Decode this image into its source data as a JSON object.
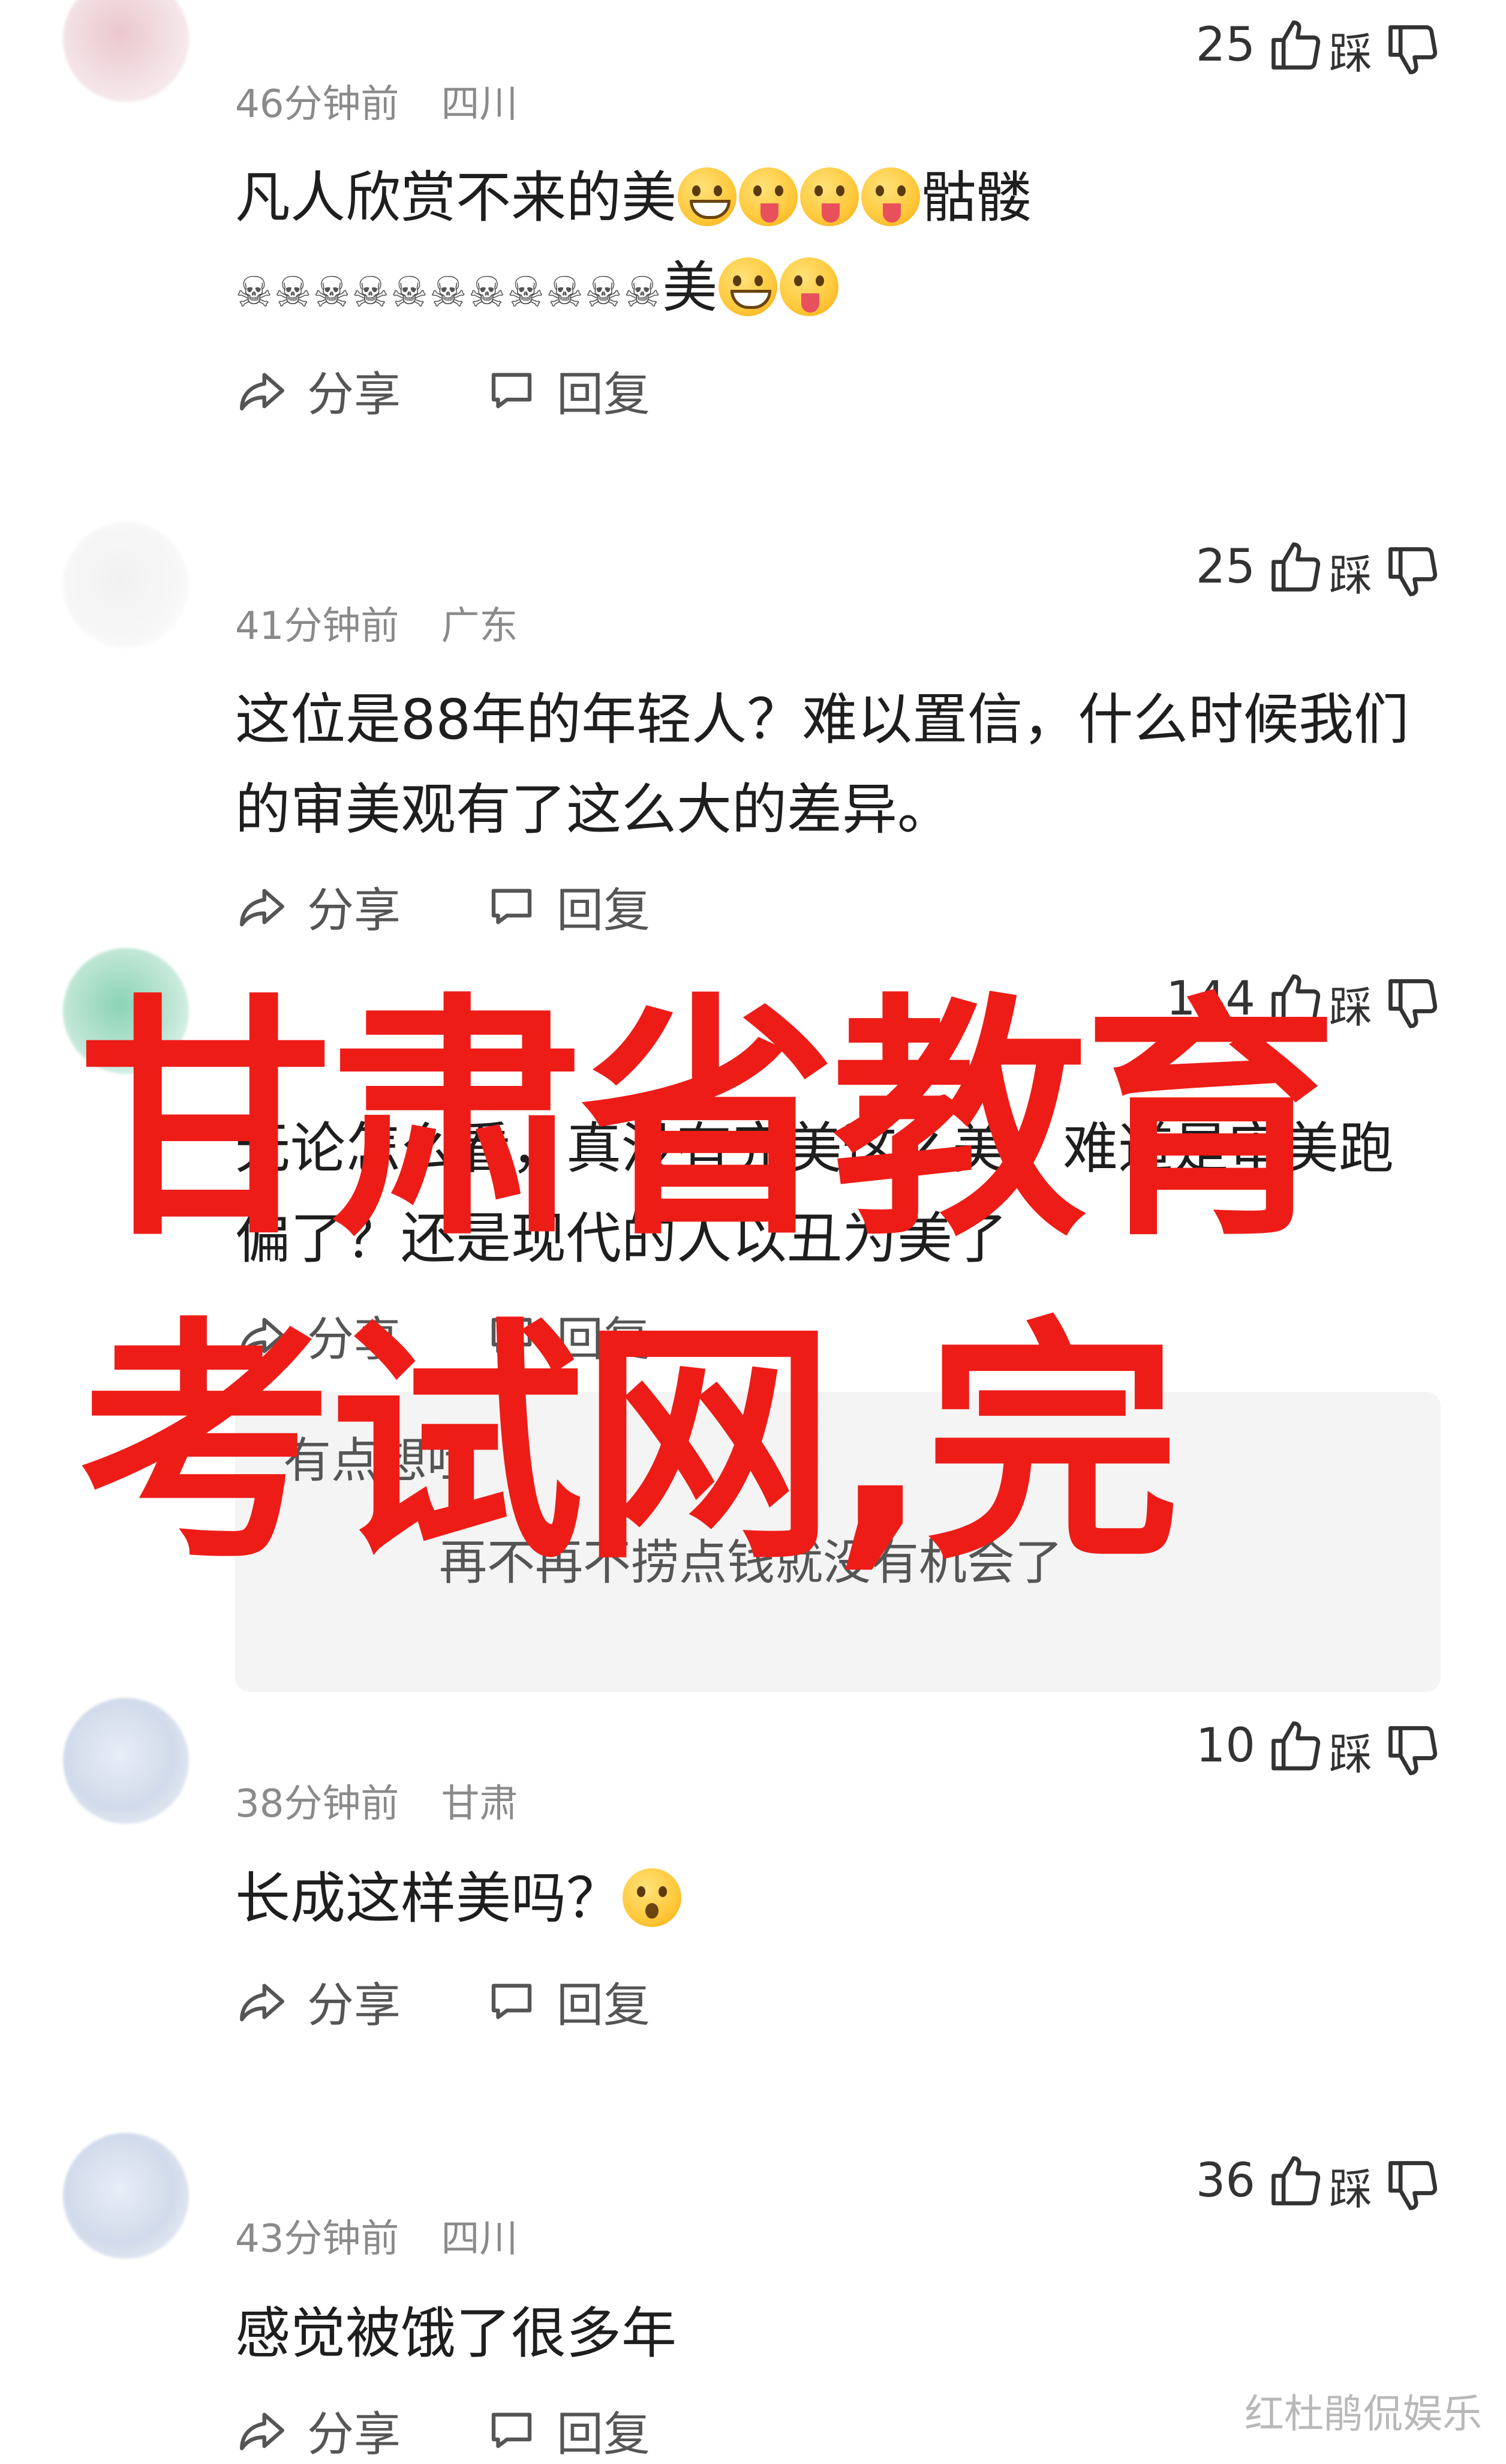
{
  "labels": {
    "share": "分享",
    "reply": "回复",
    "dislike": "踩"
  },
  "icons": {
    "share": "share-arrow-icon",
    "reply": "chat-bubble-icon",
    "like": "thumbs-up-icon",
    "dislike": "thumbs-down-icon"
  },
  "comments": [
    {
      "username": "",
      "time": "46分钟前",
      "location": "四川",
      "likes": "25",
      "line1": "凡人欣赏不来的美",
      "line1_tail": "骷髅",
      "line2_tail": "美"
    },
    {
      "username": "",
      "time": "41分钟前",
      "location": "广东",
      "likes": "25",
      "text": "这位是88年的年轻人？难以置信，什么时候我们的审美观有了这么大的差异。"
    },
    {
      "username": "",
      "time": "",
      "location": "",
      "likes": "144",
      "text": "无论怎么看，真没有完美这么美，难道是审美跑偏了？还是现代的人以丑为美了",
      "reply1": "有点想吐",
      "reply2": "再不再不捞点钱就没有机会了"
    },
    {
      "username": "",
      "time": "38分钟前",
      "location": "甘肃",
      "likes": "10",
      "text": "长成这样美吗？"
    },
    {
      "username": "",
      "time": "43分钟前",
      "location": "四川",
      "likes": "36",
      "text": "感觉被饿了很多年"
    }
  ],
  "overlay": {
    "line1": "甘肃省教育",
    "line2": "考试网,完"
  },
  "watermark": "红杜鹃侃娱乐",
  "colors": {
    "overlay_red": "#ee1c17",
    "meta_gray": "#8a8a8a",
    "text": "#1e1e1e"
  }
}
